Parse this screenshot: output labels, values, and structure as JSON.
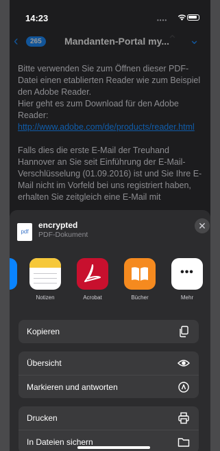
{
  "status_bar": {
    "time": "14:23",
    "signal_icon": "dots-signal-icon",
    "wifi_icon": "wifi-icon",
    "battery_icon": "battery-icon"
  },
  "nav": {
    "back_icon": "chevron-left-icon",
    "badge": "265",
    "title": "Mandanten-Portal my...",
    "up_icon": "chevron-up-icon",
    "down_icon": "chevron-down-icon"
  },
  "email": {
    "para1_text": "Bitte verwenden Sie zum Öffnen dieser PDF-Datei einen etablierten Reader wie zum Beispiel den Adobe Reader.",
    "para1_text2": "Hier geht es zum Download für den Adobe Reader: ",
    "para1_link": "http://www.adobe.com/de/products/reader.html",
    "para2": "Falls dies die erste E-Mail der Treuhand Hannover an Sie seit Einführung der E-Mail-Verschlüsselung (01.09.2016) ist und Sie Ihre E-Mail nicht im Vorfeld bei uns registriert haben, erhalten Sie zeitgleich eine E-Mail mit"
  },
  "share_sheet": {
    "file_name": "encrypted",
    "file_type": "PDF-Dokument",
    "file_icon_label": "pdf",
    "close_icon": "close-icon",
    "apps": [
      {
        "label": "Notizen",
        "icon": "notes-app-icon"
      },
      {
        "label": "Acrobat",
        "icon": "acrobat-app-icon"
      },
      {
        "label": "Bücher",
        "icon": "books-app-icon"
      },
      {
        "label": "Mehr",
        "icon": "more-icon"
      }
    ],
    "actions_group1": [
      {
        "label": "Kopieren",
        "icon": "copy-icon"
      }
    ],
    "actions_group2": [
      {
        "label": "Übersicht",
        "icon": "eye-icon"
      },
      {
        "label": "Markieren und antworten",
        "icon": "markup-icon"
      }
    ],
    "actions_group3": [
      {
        "label": "Drucken",
        "icon": "printer-icon"
      },
      {
        "label": "In Dateien sichern",
        "icon": "folder-icon"
      }
    ]
  },
  "colors": {
    "accent": "#0a84ff",
    "sheet_bg": "#2c2c2e",
    "row_bg": "#3a3a3c",
    "acrobat_red": "#c8102e",
    "books_orange": "#f58a1f",
    "notes_yellow": "#f6c83a"
  }
}
